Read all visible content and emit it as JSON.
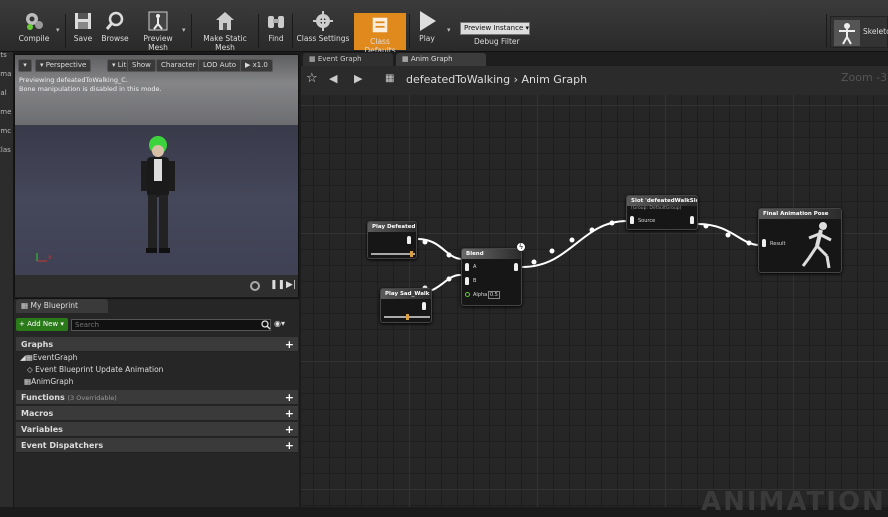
{
  "toolbar": {
    "compile": "Compile",
    "save": "Save",
    "browse": "Browse",
    "preview_mesh": "Preview Mesh",
    "make_static": "Make Static Mesh",
    "find": "Find",
    "class_settings": "Class Settings",
    "class_defaults": "Class Defaults",
    "play": "Play",
    "preview_instance": "Preview Instance ▾",
    "debug_filter": "Debug Filter",
    "skeleton": "Skeleton"
  },
  "left_strip": [
    "ncent",
    "sic",
    "nts",
    "ema",
    "ual",
    "ome",
    "umc",
    "Clas"
  ],
  "viewport": {
    "perspective": "Perspective",
    "lit": "Lit",
    "show": "Show",
    "character": "Character",
    "lod": "LOD Auto",
    "speed": "x1.0",
    "preview_text": "Previewing defeatedToWalking_C.",
    "bone_text": "Bone manipulation is disabled in this mode."
  },
  "blueprint": {
    "tab": "My Blueprint",
    "add_new": "+ Add New ▾",
    "search_placeholder": "Search",
    "graphs": "Graphs",
    "event_graph": "EventGraph",
    "event_update": "Event Blueprint Update Animation",
    "anim_graph": "AnimGraph",
    "functions": "Functions",
    "functions_count": "(3 Overridable)",
    "macros": "Macros",
    "variables": "Variables",
    "dispatchers": "Event Dispatchers"
  },
  "graph": {
    "tab1": "Event Graph",
    "tab2": "Anim Graph",
    "crumb1": "defeatedToWalking",
    "crumb_sep": "›",
    "crumb2": "Anim Graph",
    "zoom": "Zoom -3",
    "watermark": "ANIMATION"
  },
  "nodes": {
    "play_defeated": "Play Defeated",
    "play_sad": "Play Sad_Walk",
    "blend": "Blend",
    "pin_a": "A",
    "pin_b": "B",
    "alpha": "Alpha",
    "alpha_val": "0.5",
    "slot": "Slot 'defeatedWalkSlot'",
    "slot_group": "(Group: DefaultGroup)",
    "source": "Source",
    "final": "Final Animation Pose",
    "result": "Result"
  },
  "colors": {
    "accent": "#e08a1e",
    "wire": "#ffffff",
    "add_new": "#2a7a1a"
  }
}
